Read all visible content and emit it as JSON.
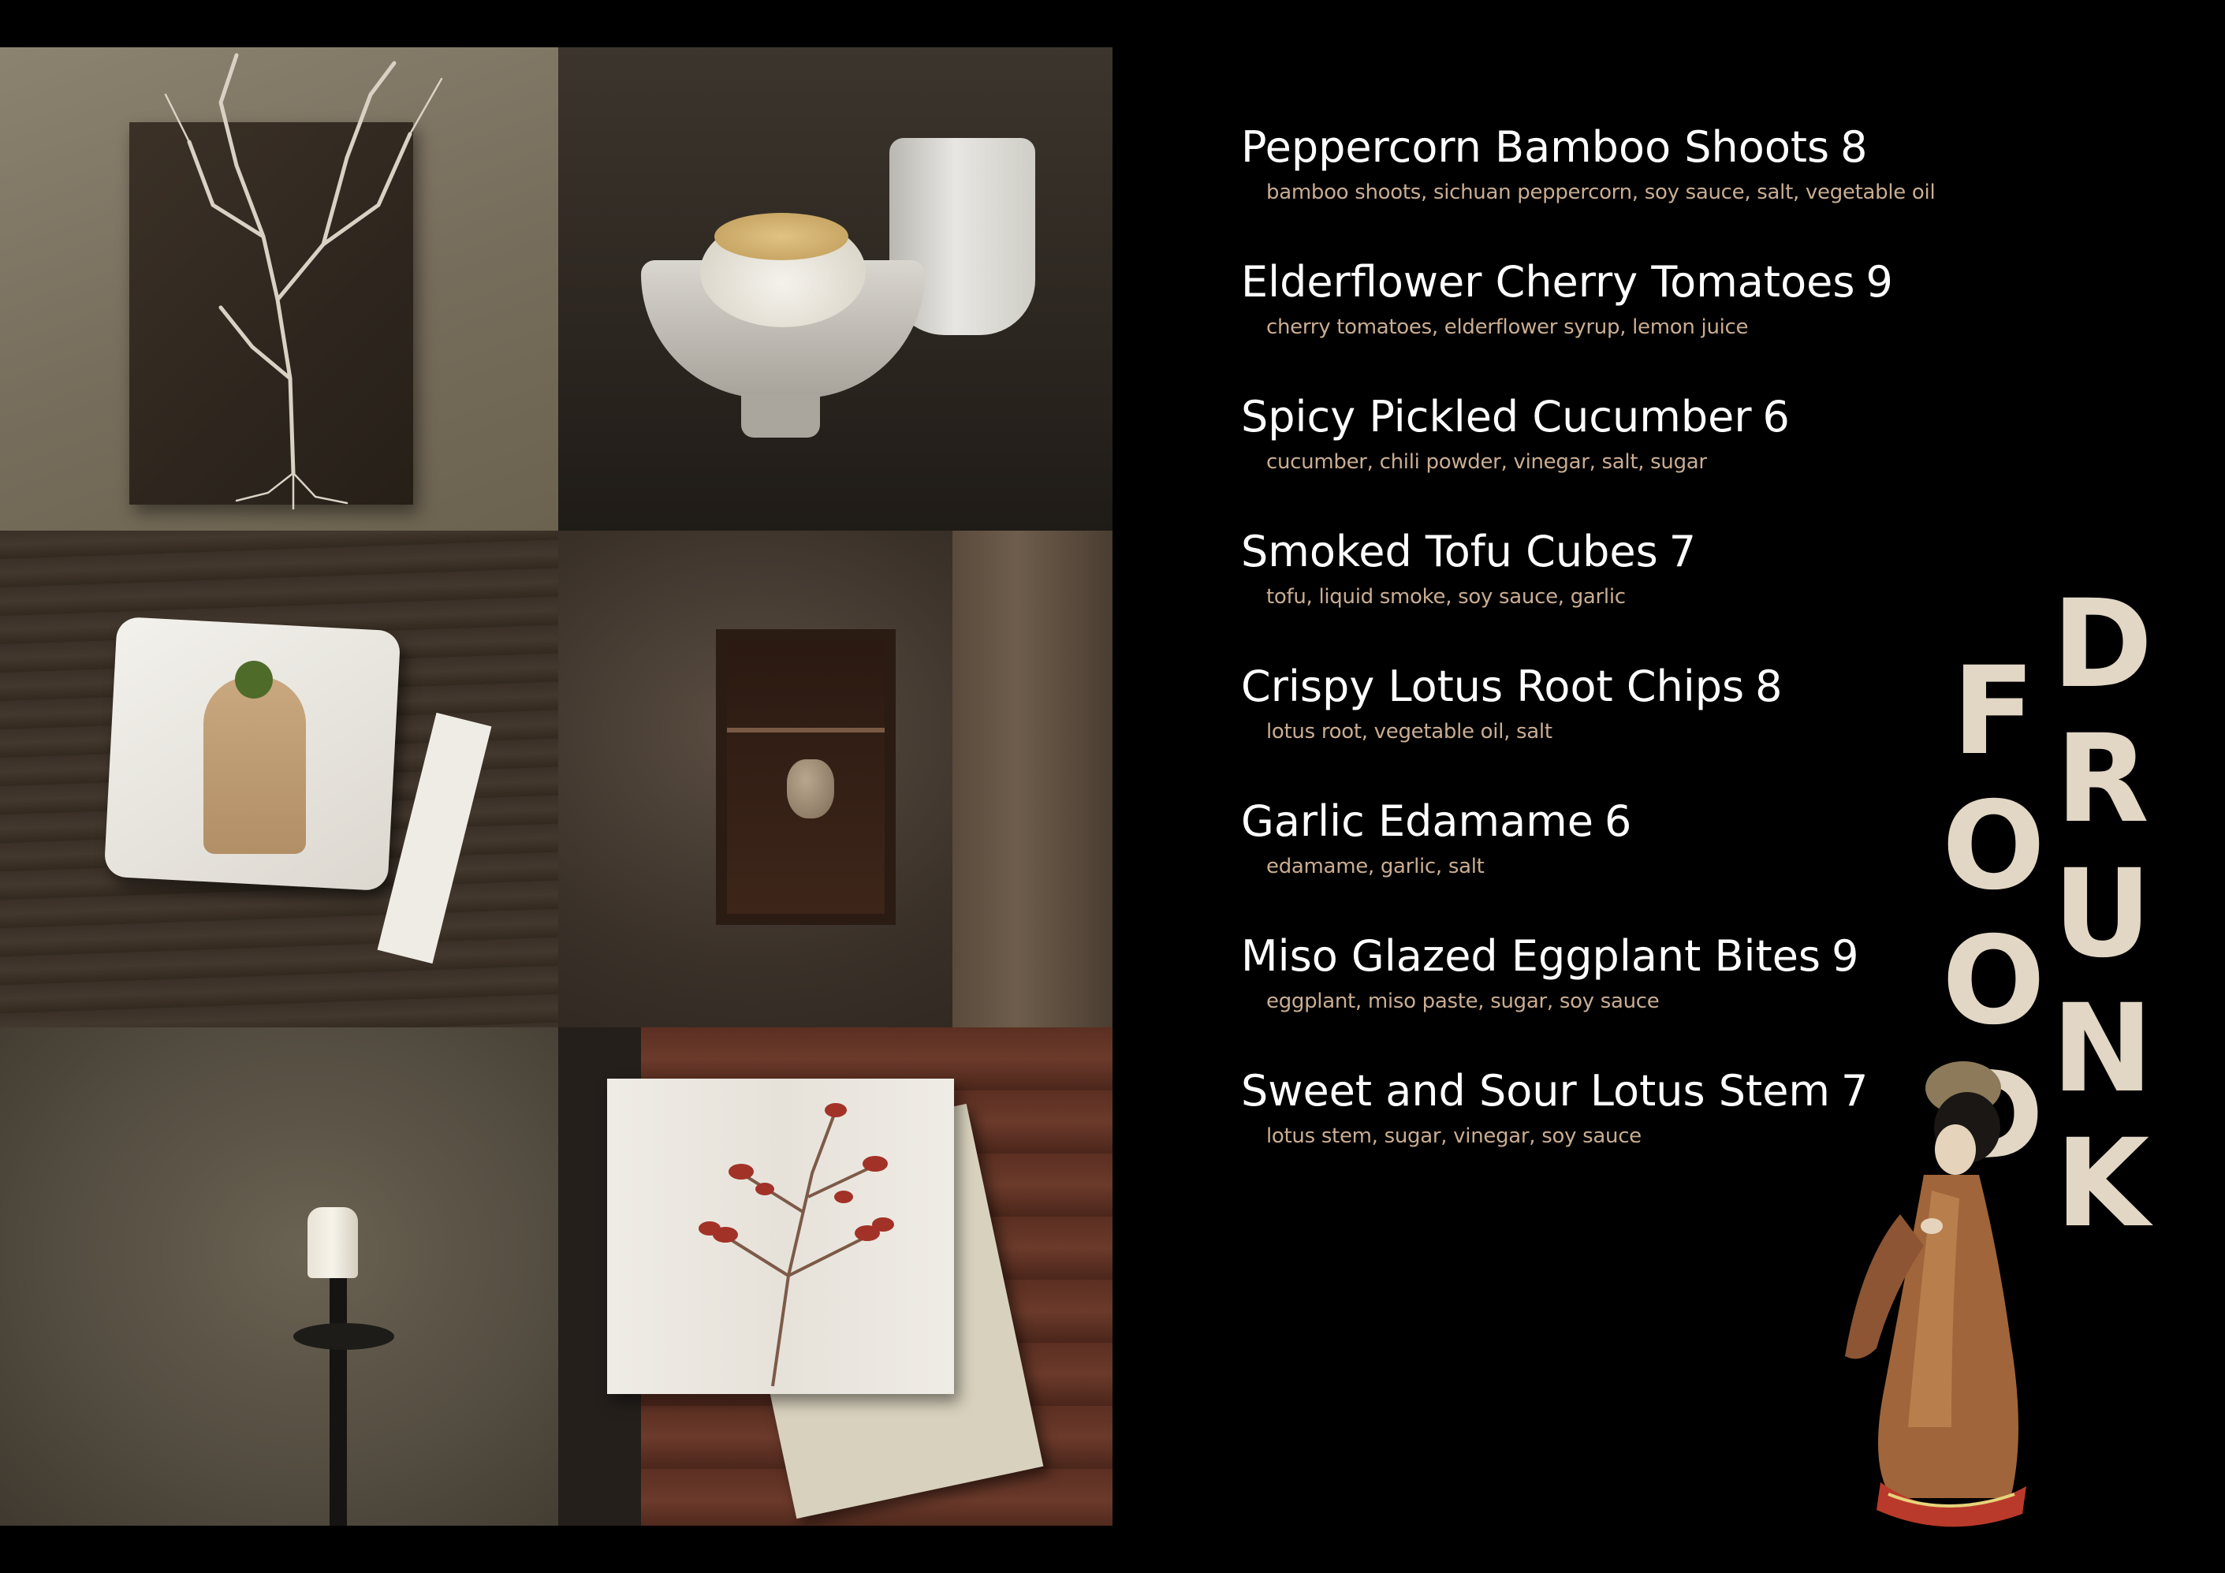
{
  "brand": {
    "title": "DRUNK FOOD"
  },
  "menu": {
    "items": [
      {
        "name": "Peppercorn Bamboo Shoots",
        "price": "8",
        "ingredients": "bamboo shoots, sichuan peppercorn, soy sauce, salt, vegetable oil"
      },
      {
        "name": "Elderflower Cherry Tomatoes",
        "price": "9",
        "ingredients": "cherry tomatoes, elderflower syrup, lemon juice"
      },
      {
        "name": "Spicy Pickled Cucumber",
        "price": "6",
        "ingredients": "cucumber, chili powder, vinegar, salt, sugar"
      },
      {
        "name": "Smoked Tofu Cubes",
        "price": "7",
        "ingredients": "tofu, liquid smoke, soy sauce, garlic"
      },
      {
        "name": "Crispy Lotus Root Chips",
        "price": "8",
        "ingredients": "lotus root, vegetable oil, salt"
      },
      {
        "name": "Garlic Edamame",
        "price": "6",
        "ingredients": "edamame, garlic, salt"
      },
      {
        "name": "Miso Glazed Eggplant Bites",
        "price": "9",
        "ingredients": "eggplant, miso paste, sugar, soy sauce"
      },
      {
        "name": "Sweet and Sour Lotus Stem",
        "price": "7",
        "ingredients": "lotus stem, sugar, vinegar, soy sauce"
      }
    ]
  },
  "colors": {
    "background": "#000000",
    "item_name": "#ffffff",
    "ingredients": "#c9ad92",
    "title": "#e2d6c5"
  }
}
